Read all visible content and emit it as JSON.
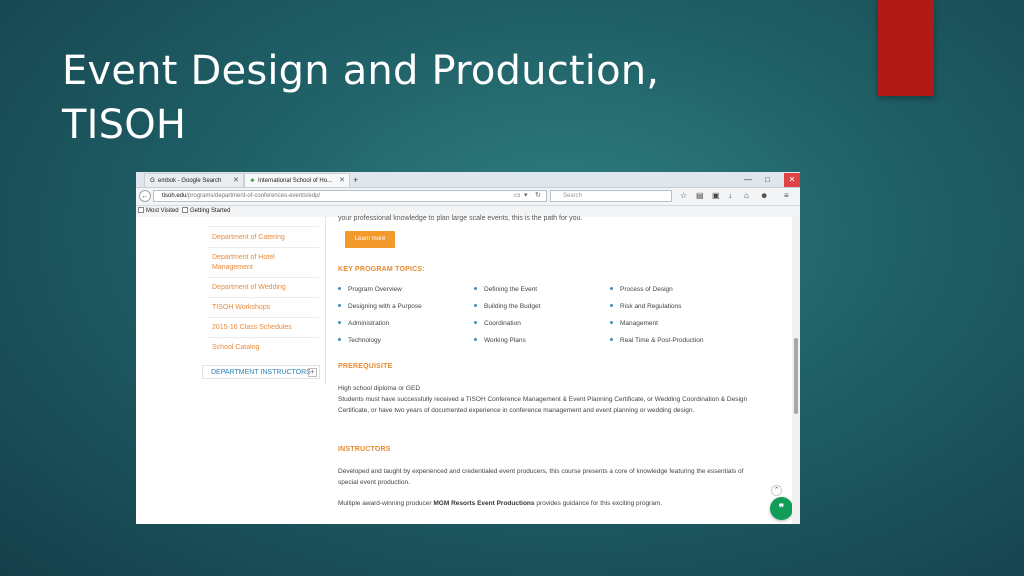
{
  "slide": {
    "title_line1": "Event Design and Production,",
    "title_line2": "TISOH"
  },
  "browser": {
    "tabs": [
      {
        "label": "embok - Google Search",
        "icon": "G"
      },
      {
        "label": "International School of Ho...",
        "icon": "♣"
      }
    ],
    "url_domain": "tisoh.edu",
    "url_path": "/programs/department-of-conferences-events/edp/",
    "search_placeholder": "Search",
    "bookmarks": [
      "Most Visited",
      "Getting Started"
    ]
  },
  "page": {
    "intro_cut": "your professional knowledge to plan large scale events, this is the path for you.",
    "learn_more": "Learn more",
    "sidebar": {
      "items": [
        "Department of Catering",
        "Department of Hotel Management",
        "Department of Wedding",
        "TISOH Workshops",
        "2015-16 Class Schedules",
        "School Catalog"
      ],
      "instructors_label": "DEPARTMENT INSTRUCTORS",
      "instructors_toggle": "+"
    },
    "key_topics": {
      "heading": "KEY PROGRAM TOPICS:",
      "columns": [
        [
          "Program Overview",
          "Designing with a Purpose",
          "Administration",
          "Technology"
        ],
        [
          "Defining the Event",
          "Building the Budget",
          "Coordination",
          "Working Plans"
        ],
        [
          "Process of Design",
          "Risk and Regulations",
          "Management",
          "Real Time & Post-Production"
        ]
      ]
    },
    "prerequisite": {
      "heading": "PREREQUISITE",
      "line1": "High school diploma or GED",
      "line2": "Students must have successfully received a TISOH Conference Management & Event Planning Certificate, or Wedding Coordination & Design Certificate, or have two years of documented experience in conference management and event planning or wedding design."
    },
    "instructors": {
      "heading": "INSTRUCTORS",
      "para1": "Developed and taught by experienced and credentialed event producers, this course presents a core of knowledge featuring the essentials of special event production.",
      "para2_pre": "Multiple award-winning producer ",
      "para2_bold": "MGM Resorts Event Productions",
      "para2_post": " provides guidance for this exciting program."
    }
  },
  "colors": {
    "accent_orange": "#e58a2f",
    "button_orange": "#f39a2c",
    "link_blue": "#2a82b6",
    "red_tab": "#b01a16",
    "chat_green": "#0f9d58"
  }
}
